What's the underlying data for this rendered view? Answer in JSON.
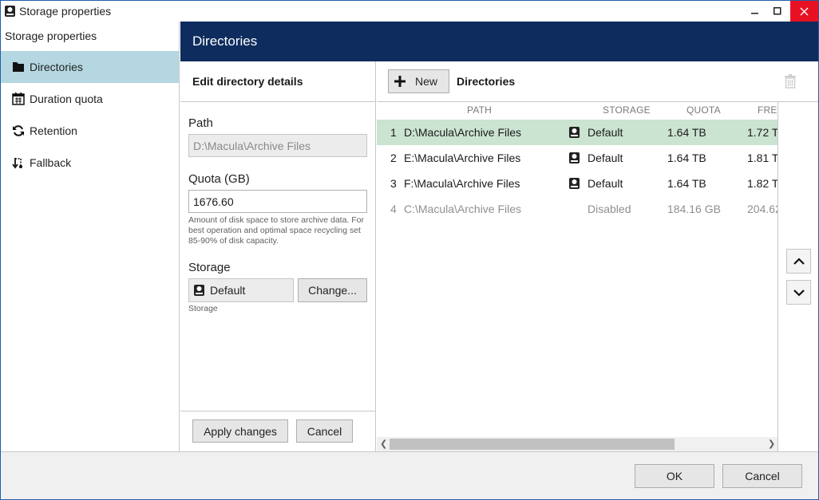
{
  "window": {
    "title": "Storage properties",
    "accent_color": "#0e2c5e",
    "close_color": "#e81123"
  },
  "sidebar": {
    "title": "Storage properties",
    "items": [
      {
        "label": "Directories",
        "icon": "folder-icon",
        "active": true
      },
      {
        "label": "Duration quota",
        "icon": "calendar-icon",
        "active": false
      },
      {
        "label": "Retention",
        "icon": "refresh-icon",
        "active": false
      },
      {
        "label": "Fallback",
        "icon": "fallback-icon",
        "active": false
      }
    ]
  },
  "header": {
    "title": "Directories"
  },
  "edit": {
    "title": "Edit directory details",
    "path_label": "Path",
    "path_value": "D:\\Macula\\Archive Files",
    "quota_label": "Quota (GB)",
    "quota_value": "1676.60",
    "quota_hint": "Amount of disk space to store archive data. For best operation and optimal space recycling set 85-90% of disk capacity.",
    "storage_label": "Storage",
    "storage_value": "Default",
    "change_label": "Change...",
    "storage_hint": "Storage",
    "apply_label": "Apply changes",
    "cancel_label": "Cancel"
  },
  "list": {
    "new_label": "New",
    "title": "Directories",
    "columns": [
      "PATH",
      "STORAGE",
      "QUOTA",
      "FREE"
    ],
    "rows": [
      {
        "num": "1",
        "path": "D:\\Macula\\Archive Files",
        "storage": "Default",
        "quota": "1.64 TB",
        "free": "1.72 T",
        "selected": true,
        "disabled": false
      },
      {
        "num": "2",
        "path": "E:\\Macula\\Archive Files",
        "storage": "Default",
        "quota": "1.64 TB",
        "free": "1.81 T",
        "selected": false,
        "disabled": false
      },
      {
        "num": "3",
        "path": "F:\\Macula\\Archive Files",
        "storage": "Default",
        "quota": "1.64 TB",
        "free": "1.82 T",
        "selected": false,
        "disabled": false
      },
      {
        "num": "4",
        "path": "C:\\Macula\\Archive Files",
        "storage": "Disabled",
        "quota": "184.16 GB",
        "free": "204.62",
        "selected": false,
        "disabled": true
      }
    ],
    "selected_row_color": "#cbe3d1"
  },
  "footer": {
    "ok_label": "OK",
    "cancel_label": "Cancel"
  }
}
